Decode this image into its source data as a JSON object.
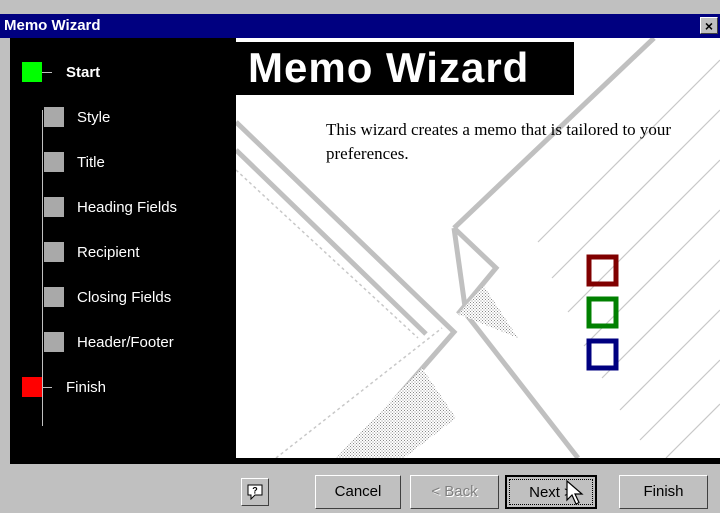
{
  "window": {
    "title": "Memo Wizard",
    "close_label": "×"
  },
  "banner": {
    "title": "Memo Wizard"
  },
  "description": "This wizard creates a memo that is tailored to your preferences.",
  "steps": [
    {
      "label": "Start",
      "color": "#00ff00",
      "active": true
    },
    {
      "label": "Style",
      "color": "#a9a9a9"
    },
    {
      "label": "Title",
      "color": "#a9a9a9"
    },
    {
      "label": "Heading Fields",
      "color": "#a9a9a9"
    },
    {
      "label": "Recipient",
      "color": "#a9a9a9"
    },
    {
      "label": "Closing Fields",
      "color": "#a9a9a9"
    },
    {
      "label": "Header/Footer",
      "color": "#a9a9a9"
    },
    {
      "label": "Finish",
      "color": "#ff0000"
    }
  ],
  "buttons": {
    "cancel": "Cancel",
    "back": "< Back",
    "next": "Next >",
    "finish": "Finish"
  },
  "icons": {
    "help": "help-question-icon",
    "cursor": "mouse-pointer-icon"
  },
  "colors": {
    "title_bar": "#000080",
    "square_red": "#800000",
    "square_green": "#008000",
    "square_blue": "#000080"
  }
}
